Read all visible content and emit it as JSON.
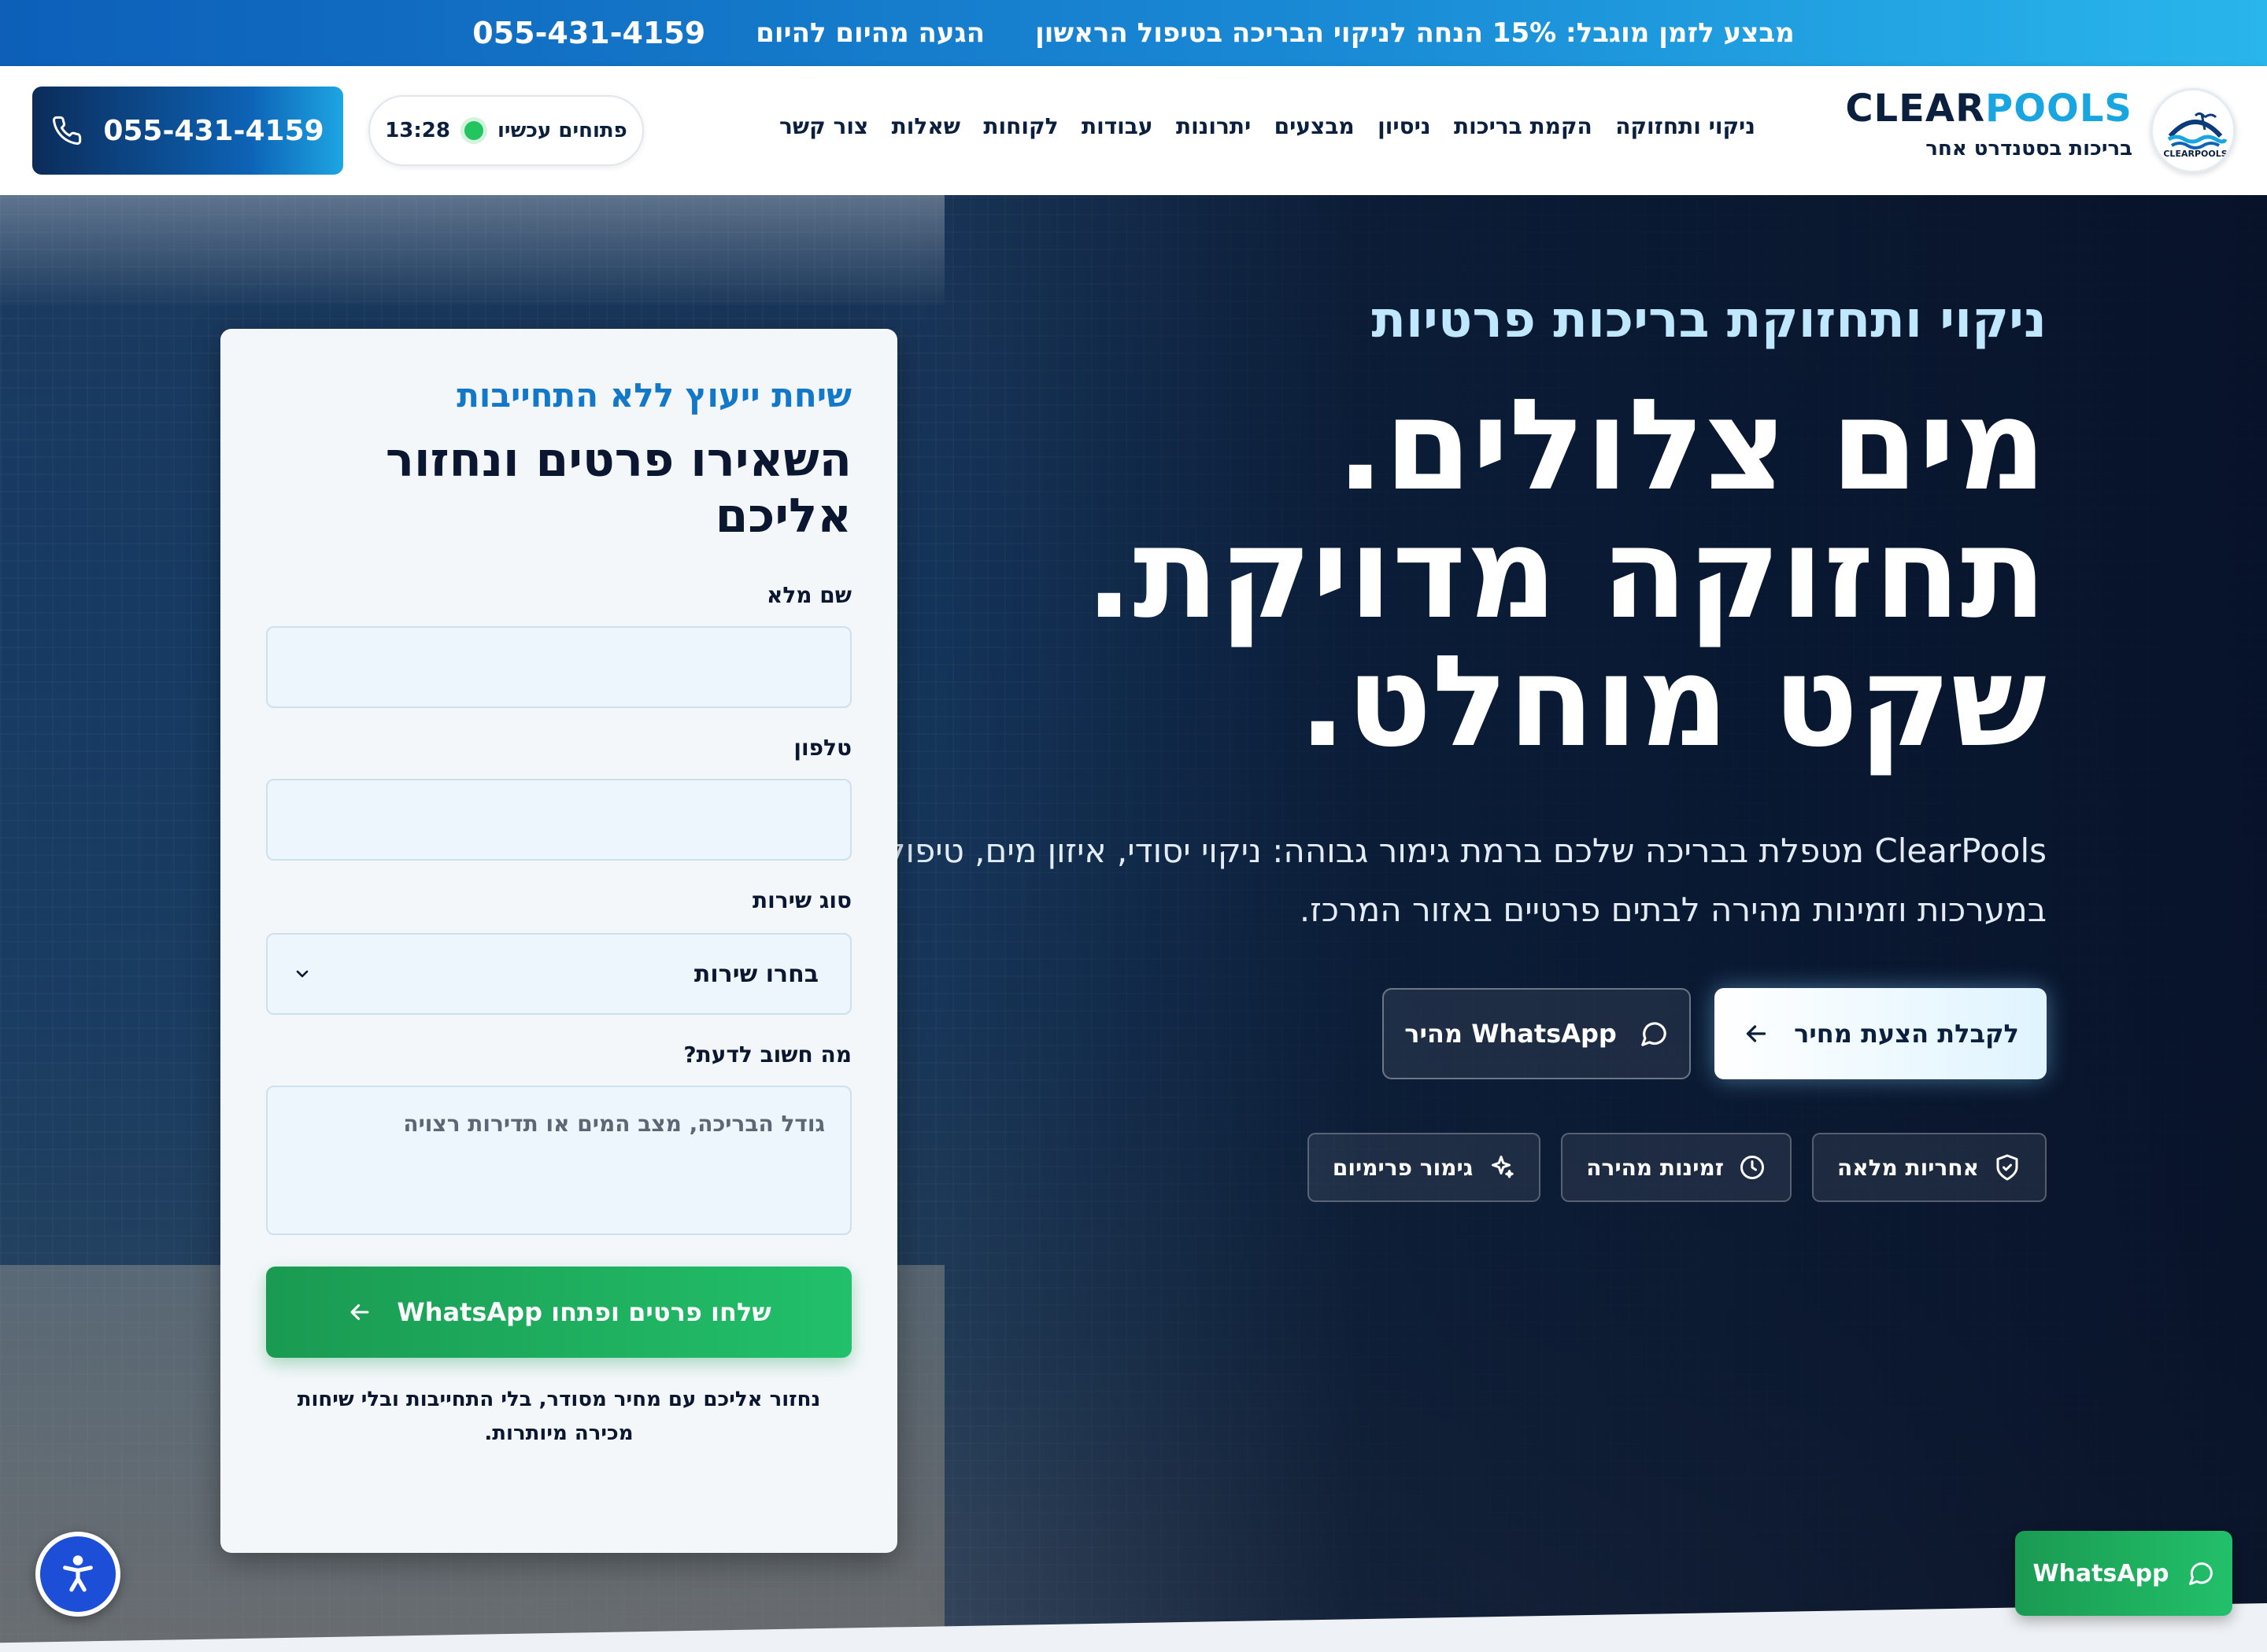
{
  "promo": {
    "offer": "מבצע לזמן מוגבל: 15% הנחה לניקוי הבריכה בטיפול הראשון",
    "today": "הגעה מהיום להיום",
    "phone": "055-431-4159"
  },
  "header": {
    "brand_a": "CLEAR",
    "brand_b": "POOLS",
    "tagline": "בריכות בסטנדרט אחר",
    "logo_icon": "pool-logo-icon",
    "nav": [
      "ניקוי ותחזוקה",
      "הקמת בריכות",
      "ניסיון",
      "מבצעים",
      "יתרונות",
      "עבודות",
      "לקוחות",
      "שאלות",
      "צור קשר"
    ],
    "open_label": "פתוחים עכשיו",
    "time": "13:28",
    "call_phone": "055-431-4159",
    "status_color": "#22c55e"
  },
  "hero": {
    "eyebrow": "ניקוי ותחזוקת בריכות פרטיות",
    "headline_1": "מים צלולים.",
    "headline_2": "תחזוקה מדויקת.",
    "headline_3": "שקט מוחלט.",
    "subtitle": "ClearPools מטפלת בבריכה שלכם ברמת גימור גבוהה: ניקוי יסודי, איזון מים, טיפול במערכות וזמינות מהירה לבתים פרטיים באזור המרכז.",
    "cta_primary": "לקבלת הצעת מחיר",
    "cta_secondary": "WhatsApp מהיר",
    "badges": [
      {
        "label": "אחריות מלאה",
        "icon": "shield-check-icon"
      },
      {
        "label": "זמינות מהירה",
        "icon": "clock-icon"
      },
      {
        "label": "גימור פרימיום",
        "icon": "sparkle-icon"
      }
    ]
  },
  "form": {
    "eyebrow": "שיחת ייעוץ ללא התחייבות",
    "title": "השאירו פרטים ונחזור אליכם",
    "name_label": "שם מלא",
    "name_value": "",
    "phone_label": "טלפון",
    "phone_value": "",
    "service_label": "סוג שירות",
    "service_value": "בחרו שירות",
    "notes_label": "מה חשוב לדעת?",
    "notes_placeholder": "גודל הבריכה, מצב המים או תדירות רצויה",
    "submit": "שלחו פרטים ופתחו WhatsApp",
    "disclaimer": "נחזור אליכם עם מחיר מסודר, בלי התחייבות ובלי שיחות מכירה מיותרות."
  },
  "floating": {
    "whatsapp": "WhatsApp",
    "accessibility_icon": "accessibility-icon"
  },
  "colors": {
    "accent_blue": "#19a6e0",
    "navy": "#0b1f3f",
    "whatsapp_green": "#22c06a"
  }
}
